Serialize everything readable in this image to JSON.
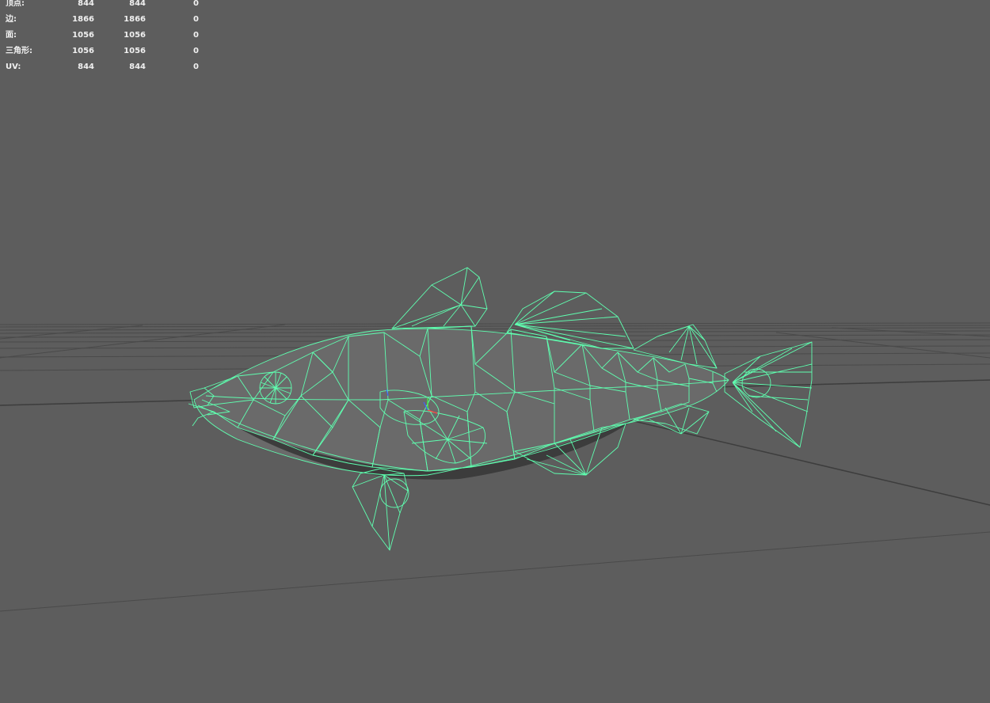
{
  "hud": {
    "rows": [
      {
        "label": "顶点:",
        "total": "844",
        "selected": "844",
        "extra": "0"
      },
      {
        "label": "边:",
        "total": "1866",
        "selected": "1866",
        "extra": "0"
      },
      {
        "label": "面:",
        "total": "1056",
        "selected": "1056",
        "extra": "0"
      },
      {
        "label": "三角形:",
        "total": "1056",
        "selected": "1056",
        "extra": "0"
      },
      {
        "label": "UV:",
        "total": "844",
        "selected": "844",
        "extra": "0"
      }
    ]
  },
  "colors": {
    "background": "#5d5d5d",
    "grid": "#4a4a4a",
    "wireframe": "#5fffb0",
    "mesh_fill": "#6e6e6e",
    "mesh_shadow": "#3a3a3a",
    "hud_text": "#f0f0f0",
    "axis_x": "#ff4040",
    "axis_y": "#40ff40",
    "axis_z": "#4060ff"
  },
  "icons": {
    "model": "fish-wireframe-icon",
    "pivot": "transform-pivot-icon"
  }
}
